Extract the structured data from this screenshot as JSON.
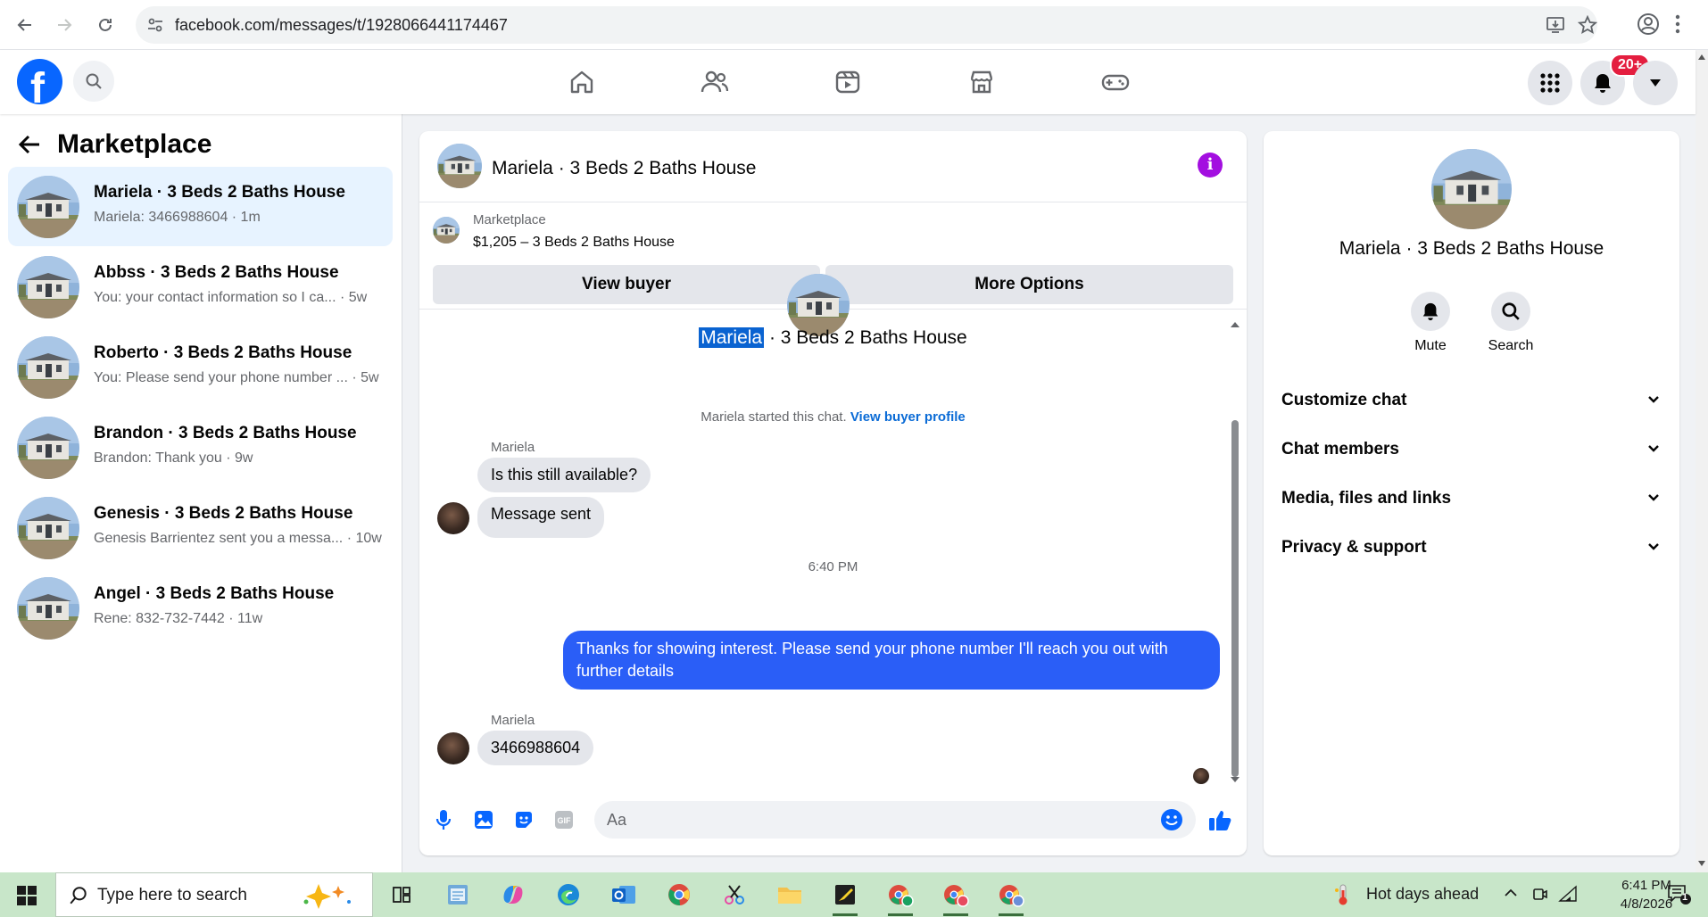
{
  "browser": {
    "url": "facebook.com/messages/t/1928066441174467"
  },
  "fb": {
    "logo": "f",
    "notifications_badge": "20+"
  },
  "sidebar": {
    "title": "Marketplace",
    "conversations": [
      {
        "name": "Mariela · 3 Beds 2 Baths House",
        "preview": "Mariela: 3466988604 · 1m",
        "active": true
      },
      {
        "name": "Abbss · 3 Beds 2 Baths House",
        "preview": "You: your contact information so I ca... · 5w",
        "active": false
      },
      {
        "name": "Roberto · 3 Beds 2 Baths House",
        "preview": "You: Please send your phone number ... · 5w",
        "active": false
      },
      {
        "name": "Brandon · 3 Beds 2 Baths House",
        "preview": "Brandon: Thank you · 9w",
        "active": false
      },
      {
        "name": "Genesis · 3 Beds 2 Baths House",
        "preview": "Genesis Barrientez sent you a messa... · 10w",
        "active": false
      },
      {
        "name": "Angel · 3 Beds 2 Baths House",
        "preview": "Rene: 832-732-7442 · 11w",
        "active": false
      }
    ]
  },
  "chat": {
    "title": "Mariela · 3 Beds 2 Baths House",
    "marketplace_label": "Marketplace",
    "listing": "$1,205 – 3 Beds 2 Baths House",
    "view_buyer": "View buyer",
    "more_options": "More Options",
    "intro_name_highlight": "Mariela",
    "intro_name_rest": " · 3 Beds 2 Baths House",
    "started_text": "Mariela started this chat. ",
    "started_link": "View buyer profile",
    "sender1": "Mariela",
    "msg1": "Is this still available?",
    "msg2": "Message sent",
    "time": "6:40 PM",
    "msg_out": "Thanks for showing interest. Please send your phone number  I'll reach you out with further details",
    "sender2": "Mariela",
    "msg3": "3466988604",
    "composer_placeholder": "Aa"
  },
  "right_panel": {
    "name": "Mariela · 3 Beds 2 Baths House",
    "mute_label": "Mute",
    "search_label": "Search",
    "sections": [
      "Customize chat",
      "Chat members",
      "Media, files and links",
      "Privacy & support"
    ]
  },
  "taskbar": {
    "search_placeholder": "Type here to search",
    "weather": "Hot days ahead",
    "time": "6:41 PM",
    "date": "4/8/2026",
    "notification_count": "1"
  },
  "colors": {
    "fb_blue": "#0866ff",
    "message_out": "#2a5ef7",
    "active_row": "#e7f3ff",
    "info_purple": "#a30fe0",
    "taskbar": "#c8e6c9"
  }
}
